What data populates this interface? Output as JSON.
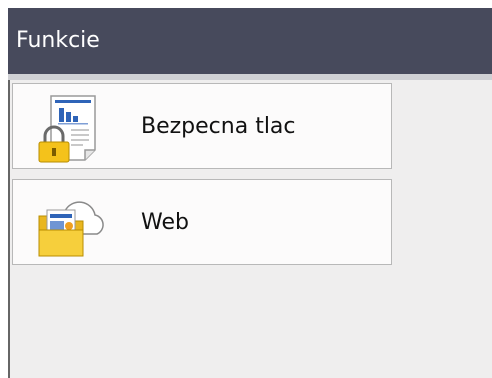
{
  "header": {
    "title": "Funkcie"
  },
  "menu": {
    "items": [
      {
        "label": "Bezpecna tlac",
        "icon": "secure-print-icon"
      },
      {
        "label": "Web",
        "icon": "web-icon"
      }
    ]
  },
  "colors": {
    "title_bar": "#474a5c",
    "background": "#efeeee",
    "item_background": "#fcfbfb",
    "lock_yellow": "#f4c21b",
    "folder_yellow": "#f6cf3c"
  }
}
